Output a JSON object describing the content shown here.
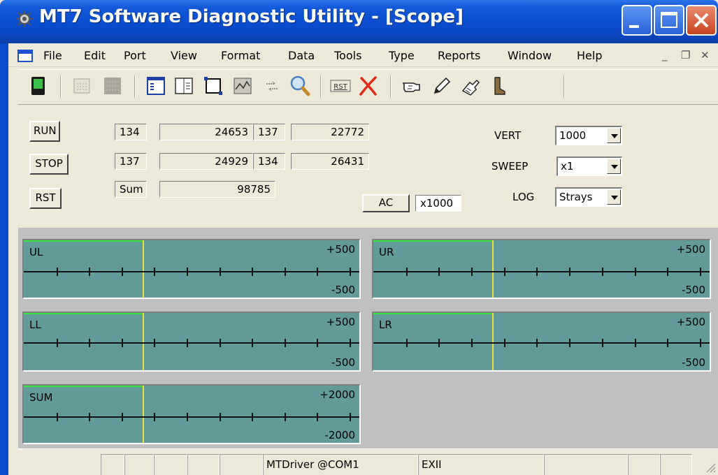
{
  "window": {
    "title": "MT7 Software Diagnostic Utility - [Scope]"
  },
  "menu": {
    "items": [
      "File",
      "Edit",
      "Port",
      "View",
      "Format",
      "Data",
      "Tools",
      "Type",
      "Reports",
      "Window",
      "Help"
    ]
  },
  "controls": {
    "run_label": "RUN",
    "stop_label": "STOP",
    "rst_label": "RST",
    "rows": [
      {
        "a": "134",
        "b": "24653",
        "c": "137",
        "d": "22772"
      },
      {
        "a": "137",
        "b": "24929",
        "c": "134",
        "d": "26431"
      }
    ],
    "sum_label": "Sum",
    "sum_value": "98785",
    "ac_label": "AC",
    "multiplier": "x1000",
    "vert_label": "VERT",
    "vert_value": "1000",
    "sweep_label": "SWEEP",
    "sweep_value": "x1",
    "log_label": "LOG",
    "log_value": "Strays"
  },
  "scopes": {
    "ul": {
      "name": "UL",
      "top": "+500",
      "bottom": "-500"
    },
    "ur": {
      "name": "UR",
      "top": "+500",
      "bottom": "-500"
    },
    "ll": {
      "name": "LL",
      "top": "+500",
      "bottom": "-500"
    },
    "lr": {
      "name": "LR",
      "top": "+500",
      "bottom": "-500"
    },
    "sum": {
      "name": "SUM",
      "top": "+2000",
      "bottom": "-2000"
    }
  },
  "status": {
    "port": "MTDriver @COM1",
    "mode": "EXII"
  },
  "colors": {
    "scope_bg": "#639a9a",
    "trigger_line": "#e8e23a",
    "top_line": "#3be33b"
  }
}
